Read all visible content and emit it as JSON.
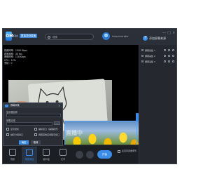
{
  "app": {
    "logo_text": "OM",
    "brand": "OM",
    "brand_cn": "屏幕录制直播",
    "search_text": "搜索",
    "user_name": "Administrator"
  },
  "window_controls": [
    "—",
    "□",
    "×"
  ],
  "sidebar": {
    "add_label": "添加屏幕来源",
    "scenes": [
      {
        "label": "屏幕采集 1"
      },
      {
        "label": "屏幕采集 2"
      },
      {
        "label": "屏幕采集 3"
      }
    ]
  },
  "stats": [
    "视频码率：1500 Kbps",
    "视频帧率：30 fps",
    "音频码率：128 Kbps",
    "CPU：12%",
    "丢帧：0"
  ],
  "overlay_text": "直播中",
  "dialog": {
    "title": "屏幕采集",
    "close": "×",
    "name_label": "显示器名称",
    "name_value": "",
    "area_label": "采集区域",
    "area_value": "",
    "browse_label": "...",
    "options": [
      {
        "label": "显示鼠标"
      },
      {
        "label": "捕获窗口（兼容模式）"
      },
      {
        "label": "捕获分层窗口"
      },
      {
        "label": "屏蔽其他应用程序窗口"
      }
    ],
    "ok_label": "确定",
    "cancel_label": "取消"
  },
  "toolbar": {
    "tools": [
      {
        "label": "场景",
        "icon": "scene-icon"
      },
      {
        "label": "来源添加",
        "icon": "source-icon"
      },
      {
        "label": "画中画",
        "icon": "pip-icon"
      },
      {
        "label": "文字",
        "icon": "text-icon"
      }
    ],
    "start_label": "开始",
    "mic_label": "麦克风音量调节"
  },
  "colors": {
    "accent": "#3b8de8",
    "background": "#20232a",
    "panel": "#2b2f37"
  }
}
